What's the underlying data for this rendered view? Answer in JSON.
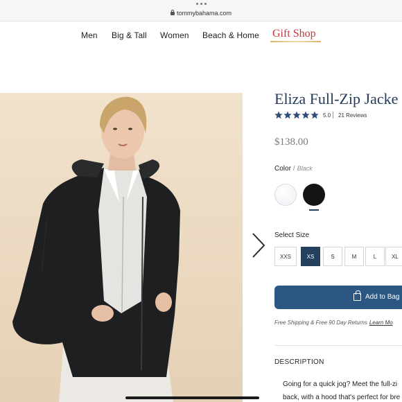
{
  "browser": {
    "url": "tommybahama.com"
  },
  "nav": {
    "items": [
      "Men",
      "Big & Tall",
      "Women",
      "Beach & Home"
    ],
    "gift_shop": "Gift Shop"
  },
  "product": {
    "title": "Eliza Full-Zip Jacke",
    "rating_value": "5.0",
    "star_count": 5,
    "reviews": "21 Reviews",
    "price": "$138.00",
    "color_label": "Color",
    "color_value": "Black",
    "color_swatches": [
      "white",
      "black"
    ],
    "selected_swatch": "black",
    "size_label": "Select Size",
    "sizes": [
      "XXS",
      "XS",
      "S",
      "M",
      "L",
      "XL"
    ],
    "selected_size": "XS",
    "add_to_bag": "Add to Bag",
    "shipping_text": "Free Shipping & Free 90 Day Returns",
    "shipping_link": "Learn Mo",
    "description_title": "DESCRIPTION",
    "description_lines": [
      "Going for a quick jog? Meet the full-zi",
      "back, with a hood that's perfect for bre"
    ]
  },
  "icons": {
    "lock": "lock-icon",
    "star": "star-icon",
    "next": "chevron-right-icon",
    "bag": "shopping-bag-icon"
  },
  "colors": {
    "brand_navy": "#24405f",
    "button_blue": "#2b5782",
    "gift_red": "#c7353e",
    "star_blue": "#2d4f77"
  }
}
